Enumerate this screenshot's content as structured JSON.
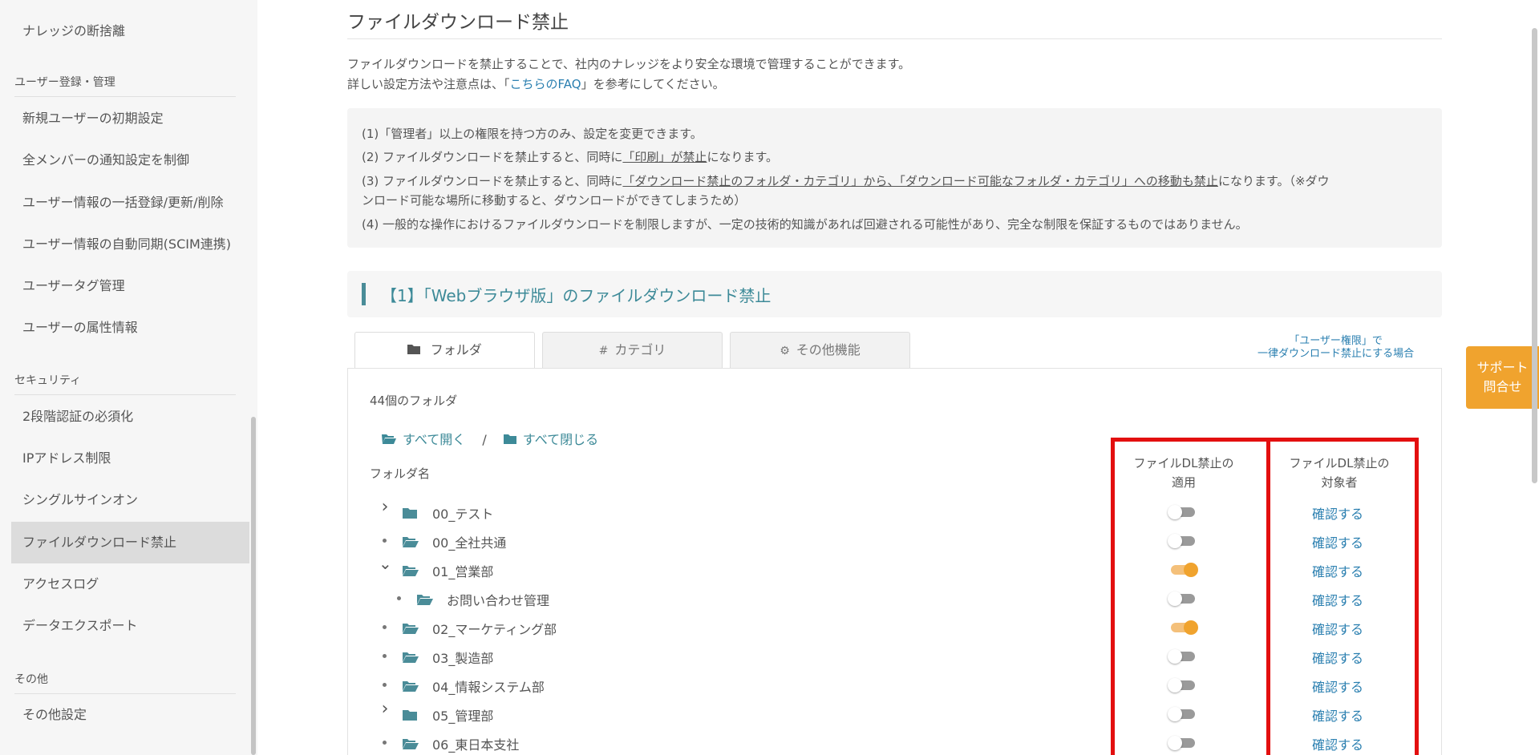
{
  "sidebar": {
    "sections": [
      {
        "label": "ユーザー登録・管理"
      },
      {
        "label": "セキュリティ"
      },
      {
        "label": "その他"
      }
    ],
    "items": [
      {
        "label": "ナレッジの断捨離"
      },
      {
        "label": "新規ユーザーの初期設定"
      },
      {
        "label": "全メンバーの通知設定を制御"
      },
      {
        "label": "ユーザー情報の一括登録/更新/削除"
      },
      {
        "label": "ユーザー情報の自動同期(SCIM連携)"
      },
      {
        "label": "ユーザータグ管理"
      },
      {
        "label": "ユーザーの属性情報"
      },
      {
        "label": "2段階認証の必須化"
      },
      {
        "label": "IPアドレス制限"
      },
      {
        "label": "シングルサインオン"
      },
      {
        "label": "ファイルダウンロード禁止"
      },
      {
        "label": "アクセスログ"
      },
      {
        "label": "データエクスポート"
      },
      {
        "label": "その他設定"
      }
    ]
  },
  "page": {
    "title": "ファイルダウンロード禁止",
    "desc1": "ファイルダウンロードを禁止することで、社内のナレッジをより安全な環境で管理することができます。",
    "desc2_pre": "詳しい設定方法や注意点は、「",
    "desc2_link": "こちらのFAQ",
    "desc2_post": "」を参考にしてください。"
  },
  "notes": {
    "n1": "(1)「管理者」以上の権限を持つ方のみ、設定を変更できます。",
    "n2_pre": "(2) ファイルダウンロードを禁止すると、同時に",
    "n2_u": "「印刷」が禁止",
    "n2_post": "になります。",
    "n3_pre": "(3) ファイルダウンロードを禁止すると、同時に",
    "n3_u": "「ダウンロード禁止のフォルダ・カテゴリ」から、「ダウンロード可能なフォルダ・カテゴリ」への移動も禁止",
    "n3_post": "になります。（※ダウ",
    "n3_line2": "ンロード可能な場所に移動すると、ダウンロードができてしまうため）",
    "n4": "(4) 一般的な操作におけるファイルダウンロードを制限しますが、一定の技術的知識があれば回避される可能性があり、完全な制限を保証するものではありません。"
  },
  "section": {
    "title": "【1】「Webブラウザ版」のファイルダウンロード禁止"
  },
  "tabs": [
    {
      "label": "フォルダ",
      "icon": "folder-icon"
    },
    {
      "label": "カテゴリ",
      "icon": "hash-icon"
    },
    {
      "label": "その他機能",
      "icon": "gear-icon"
    }
  ],
  "tab_link": {
    "line1": "「ユーザー権限」で",
    "line2": "一律ダウンロード禁止にする場合"
  },
  "folders": {
    "count": "44個のフォルダ",
    "open_all": "すべて開く",
    "separator": "/",
    "close_all": "すべて閉じる",
    "col_name": "フォルダ名",
    "col_apply_1": "ファイルDL禁止の",
    "col_apply_2": "適用",
    "col_target_1": "ファイルDL禁止の",
    "col_target_2": "対象者",
    "confirm_label": "確認する",
    "rows": [
      {
        "name": "00_テスト",
        "marker": "caret-right",
        "folder": "closed",
        "indent": 0,
        "enabled": false
      },
      {
        "name": "00_全社共通",
        "marker": "dot",
        "folder": "open",
        "indent": 0,
        "enabled": false
      },
      {
        "name": "01_営業部",
        "marker": "caret-down",
        "folder": "open",
        "indent": 0,
        "enabled": true
      },
      {
        "name": "お問い合わせ管理",
        "marker": "dot",
        "folder": "open",
        "indent": 1,
        "enabled": false
      },
      {
        "name": "02_マーケティング部",
        "marker": "dot",
        "folder": "open",
        "indent": 0,
        "enabled": true
      },
      {
        "name": "03_製造部",
        "marker": "dot",
        "folder": "open",
        "indent": 0,
        "enabled": false
      },
      {
        "name": "04_情報システム部",
        "marker": "dot",
        "folder": "open",
        "indent": 0,
        "enabled": false
      },
      {
        "name": "05_管理部",
        "marker": "caret-right",
        "folder": "closed",
        "indent": 0,
        "enabled": false
      },
      {
        "name": "06_東日本支社",
        "marker": "dot",
        "folder": "open",
        "indent": 0,
        "enabled": false
      }
    ]
  },
  "support": {
    "line1": "サポート",
    "line2": "問合せ"
  },
  "colors": {
    "accent": "#3d8a98",
    "link": "#2a7fb0",
    "toggle_on": "#f0a32e",
    "highlight": "#e30f0f"
  }
}
